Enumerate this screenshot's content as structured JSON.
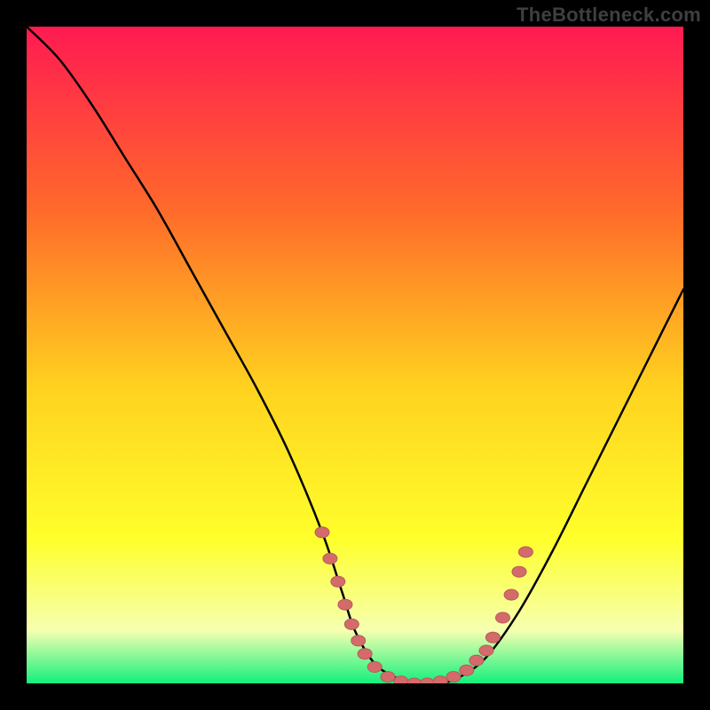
{
  "watermark": "TheBottleneck.com",
  "colors": {
    "gradient_top": "#ff1a52",
    "gradient_mid_upper": "#ff6a2a",
    "gradient_mid": "#ffd21f",
    "gradient_mid_lower": "#ffff2b",
    "gradient_lower": "#f5ffb0",
    "gradient_bottom": "#13f07c",
    "curve": "#000000",
    "dot": "#d46b6b",
    "frame": "#000000"
  },
  "chart_data": {
    "type": "line",
    "title": "",
    "xlabel": "",
    "ylabel": "",
    "xlim": [
      0,
      100
    ],
    "ylim": [
      0,
      100
    ],
    "series": [
      {
        "name": "bottleneck-curve",
        "x": [
          0,
          5,
          10,
          15,
          20,
          25,
          30,
          35,
          40,
          45,
          48,
          50,
          53,
          56,
          58,
          60,
          63,
          66,
          70,
          75,
          80,
          85,
          90,
          95,
          100
        ],
        "y": [
          100,
          95,
          88,
          80,
          72,
          63,
          54,
          45,
          35,
          23,
          14,
          8,
          3,
          1,
          0,
          0,
          0,
          1,
          4,
          11,
          20,
          30,
          40,
          50,
          60
        ]
      }
    ],
    "markers": [
      {
        "x": 45,
        "y": 23
      },
      {
        "x": 46.2,
        "y": 19
      },
      {
        "x": 47.4,
        "y": 15.5
      },
      {
        "x": 48.5,
        "y": 12
      },
      {
        "x": 49.5,
        "y": 9
      },
      {
        "x": 50.5,
        "y": 6.5
      },
      {
        "x": 51.5,
        "y": 4.5
      },
      {
        "x": 53.0,
        "y": 2.5
      },
      {
        "x": 55.0,
        "y": 1.0
      },
      {
        "x": 57.0,
        "y": 0.3
      },
      {
        "x": 59.0,
        "y": 0.0
      },
      {
        "x": 61.0,
        "y": 0.0
      },
      {
        "x": 63.0,
        "y": 0.3
      },
      {
        "x": 65.0,
        "y": 1.0
      },
      {
        "x": 67.0,
        "y": 2.0
      },
      {
        "x": 68.5,
        "y": 3.5
      },
      {
        "x": 70.0,
        "y": 5.0
      },
      {
        "x": 71.0,
        "y": 7.0
      },
      {
        "x": 72.5,
        "y": 10.0
      },
      {
        "x": 73.8,
        "y": 13.5
      },
      {
        "x": 75.0,
        "y": 17.0
      },
      {
        "x": 76.0,
        "y": 20.0
      }
    ]
  }
}
